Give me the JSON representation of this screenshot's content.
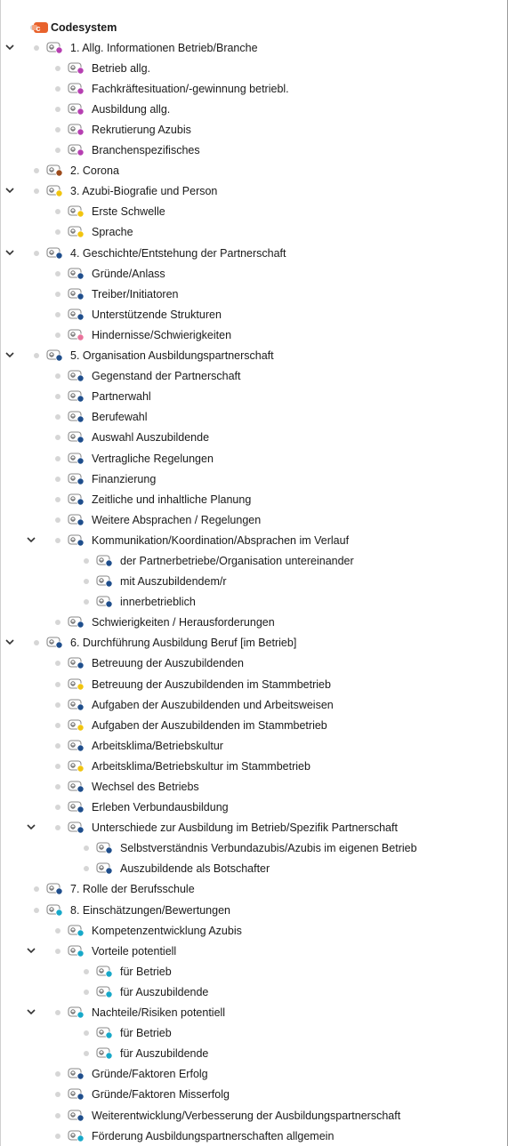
{
  "root": {
    "label": "Codesystem"
  },
  "colors": {
    "root_icon": "#e8622c",
    "purple": "#b63fb1",
    "brown": "#9c4a1b",
    "yellow": "#f1c40f",
    "navy": "#1f4e8c",
    "pink": "#e9739b",
    "cyan": "#17a8c9"
  },
  "tree": [
    {
      "level": 0,
      "expanded": true,
      "color": "purple",
      "label": "1. Allg. Informationen Betrieb/Branche"
    },
    {
      "level": 1,
      "expanded": null,
      "color": "purple",
      "label": "Betrieb allg."
    },
    {
      "level": 1,
      "expanded": null,
      "color": "purple",
      "label": "Fachkräftesituation/-gewinnung betriebl."
    },
    {
      "level": 1,
      "expanded": null,
      "color": "purple",
      "label": "Ausbildung allg."
    },
    {
      "level": 1,
      "expanded": null,
      "color": "purple",
      "label": "Rekrutierung Azubis"
    },
    {
      "level": 1,
      "expanded": null,
      "color": "purple",
      "label": "Branchenspezifisches"
    },
    {
      "level": 0,
      "expanded": null,
      "color": "brown",
      "label": "2. Corona"
    },
    {
      "level": 0,
      "expanded": true,
      "color": "yellow",
      "label": "3. Azubi-Biografie und Person"
    },
    {
      "level": 1,
      "expanded": null,
      "color": "yellow",
      "label": "Erste Schwelle"
    },
    {
      "level": 1,
      "expanded": null,
      "color": "yellow",
      "label": "Sprache"
    },
    {
      "level": 0,
      "expanded": true,
      "color": "navy",
      "label": "4. Geschichte/Entstehung der Partnerschaft"
    },
    {
      "level": 1,
      "expanded": null,
      "color": "navy",
      "label": "Gründe/Anlass"
    },
    {
      "level": 1,
      "expanded": null,
      "color": "navy",
      "label": "Treiber/Initiatoren"
    },
    {
      "level": 1,
      "expanded": null,
      "color": "navy",
      "label": "Unterstützende Strukturen"
    },
    {
      "level": 1,
      "expanded": null,
      "color": "pink",
      "label": "Hindernisse/Schwierigkeiten"
    },
    {
      "level": 0,
      "expanded": true,
      "color": "navy",
      "label": "5. Organisation Ausbildungspartnerschaft"
    },
    {
      "level": 1,
      "expanded": null,
      "color": "navy",
      "label": "Gegenstand der Partnerschaft"
    },
    {
      "level": 1,
      "expanded": null,
      "color": "navy",
      "label": "Partnerwahl"
    },
    {
      "level": 1,
      "expanded": null,
      "color": "navy",
      "label": "Berufewahl"
    },
    {
      "level": 1,
      "expanded": null,
      "color": "navy",
      "label": "Auswahl Auszubildende"
    },
    {
      "level": 1,
      "expanded": null,
      "color": "navy",
      "label": "Vertragliche Regelungen"
    },
    {
      "level": 1,
      "expanded": null,
      "color": "navy",
      "label": "Finanzierung"
    },
    {
      "level": 1,
      "expanded": null,
      "color": "navy",
      "label": "Zeitliche und inhaltliche Planung"
    },
    {
      "level": 1,
      "expanded": null,
      "color": "navy",
      "label": "Weitere Absprachen / Regelungen"
    },
    {
      "level": 1,
      "expanded": true,
      "color": "navy",
      "label": "Kommunikation/Koordination/Absprachen im Verlauf"
    },
    {
      "level": 2,
      "expanded": null,
      "color": "navy",
      "label": "der Partnerbetriebe/Organisation untereinander"
    },
    {
      "level": 2,
      "expanded": null,
      "color": "navy",
      "label": "mit Auszubildendem/r"
    },
    {
      "level": 2,
      "expanded": null,
      "color": "navy",
      "label": "innerbetrieblich"
    },
    {
      "level": 1,
      "expanded": null,
      "color": "navy",
      "label": "Schwierigkeiten / Herausforderungen"
    },
    {
      "level": 0,
      "expanded": true,
      "color": "navy",
      "label": "6. Durchführung Ausbildung Beruf [im Betrieb]"
    },
    {
      "level": 1,
      "expanded": null,
      "color": "navy",
      "label": "Betreuung der Auszubildenden"
    },
    {
      "level": 1,
      "expanded": null,
      "color": "yellow",
      "label": "Betreuung der Auszubildenden im Stammbetrieb"
    },
    {
      "level": 1,
      "expanded": null,
      "color": "navy",
      "label": "Aufgaben der Auszubildenden und Arbeitsweisen"
    },
    {
      "level": 1,
      "expanded": null,
      "color": "yellow",
      "label": "Aufgaben der Auszubildenden im Stammbetrieb"
    },
    {
      "level": 1,
      "expanded": null,
      "color": "navy",
      "label": "Arbeitsklima/Betriebskultur"
    },
    {
      "level": 1,
      "expanded": null,
      "color": "yellow",
      "label": "Arbeitsklima/Betriebskultur im Stammbetrieb"
    },
    {
      "level": 1,
      "expanded": null,
      "color": "navy",
      "label": "Wechsel des Betriebs"
    },
    {
      "level": 1,
      "expanded": null,
      "color": "navy",
      "label": "Erleben Verbundausbildung"
    },
    {
      "level": 1,
      "expanded": true,
      "color": "navy",
      "label": "Unterschiede zur Ausbildung im Betrieb/Spezifik Partnerschaft"
    },
    {
      "level": 2,
      "expanded": null,
      "color": "navy",
      "label": "Selbstverständnis Verbundazubis/Azubis im eigenen Betrieb"
    },
    {
      "level": 2,
      "expanded": null,
      "color": "navy",
      "label": "Auszubildende als Botschafter"
    },
    {
      "level": 0,
      "expanded": null,
      "color": "navy",
      "label": "7. Rolle der Berufsschule"
    },
    {
      "level": 0,
      "expanded": null,
      "color": "cyan",
      "label": "8. Einschätzungen/Bewertungen"
    },
    {
      "level": 1,
      "expanded": null,
      "color": "cyan",
      "label": "Kompetenzentwicklung Azubis"
    },
    {
      "level": 1,
      "expanded": true,
      "color": "cyan",
      "label": "Vorteile potentiell"
    },
    {
      "level": 2,
      "expanded": null,
      "color": "cyan",
      "label": "für Betrieb"
    },
    {
      "level": 2,
      "expanded": null,
      "color": "cyan",
      "label": "für Auszubildende"
    },
    {
      "level": 1,
      "expanded": true,
      "color": "cyan",
      "label": "Nachteile/Risiken potentiell"
    },
    {
      "level": 2,
      "expanded": null,
      "color": "cyan",
      "label": "für Betrieb"
    },
    {
      "level": 2,
      "expanded": null,
      "color": "cyan",
      "label": "für Auszubildende"
    },
    {
      "level": 1,
      "expanded": null,
      "color": "navy",
      "label": "Gründe/Faktoren Erfolg"
    },
    {
      "level": 1,
      "expanded": null,
      "color": "navy",
      "label": "Gründe/Faktoren Misserfolg"
    },
    {
      "level": 1,
      "expanded": null,
      "color": "navy",
      "label": "Weiterentwicklung/Verbesserung der Ausbildungspartnerschaft"
    },
    {
      "level": 1,
      "expanded": null,
      "color": "cyan",
      "label": "Förderung Ausbildungspartnerschaften allgemein"
    }
  ]
}
